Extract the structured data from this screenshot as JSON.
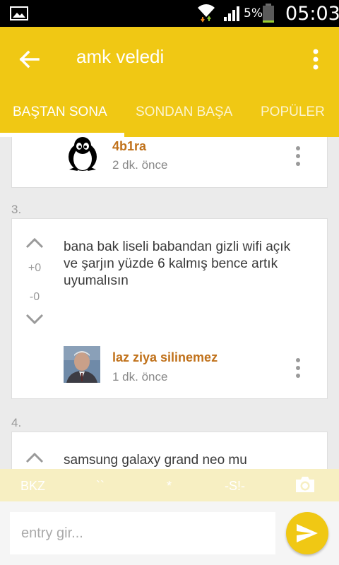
{
  "status_bar": {
    "battery_percent": "5%",
    "time": "05:03",
    "icons": [
      "image-icon",
      "wifi-icon",
      "signal-icon",
      "battery-icon"
    ]
  },
  "app_bar": {
    "title": "amk veledi",
    "icons": [
      "back-arrow-icon",
      "more-vert-icon"
    ]
  },
  "tabs": [
    {
      "label": "BAŞTAN SONA",
      "active": true
    },
    {
      "label": "SONDAN BAŞA",
      "active": false
    },
    {
      "label": "POPÜLER",
      "active": false
    }
  ],
  "entries": [
    {
      "author": "4b1ra",
      "ago": "2 dk. önce",
      "avatar": "penguin-icon"
    },
    {
      "number": "3.",
      "upvotes": "+0",
      "downvotes": "-0",
      "text": "bana bak liseli babandan gizli wifi açık ve şarjın yüzde 6 kalmış bence artık uyumalısın",
      "author": "laz ziya silinemez",
      "ago": "1 dk. önce",
      "avatar": "user-photo"
    },
    {
      "number": "4.",
      "text": "samsung galaxy grand neo mu"
    }
  ],
  "shortcuts": {
    "bkz": "BKZ",
    "backtick": "``",
    "star": "*",
    "spoiler": "-S!-",
    "camera_icon": "camera-icon"
  },
  "input": {
    "placeholder": "entry gir...",
    "send_icon": "send-icon"
  },
  "colors": {
    "accent": "#f0c814",
    "author": "#c0711a"
  }
}
